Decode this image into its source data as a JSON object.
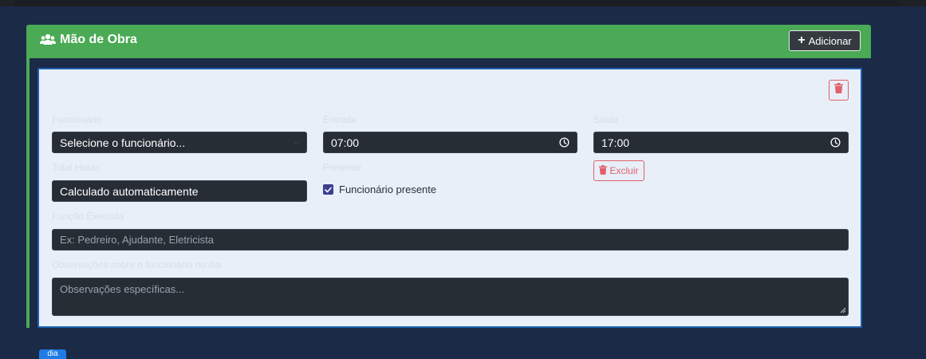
{
  "section": {
    "title": "Mão de Obra",
    "title_icon": "users-icon",
    "add_button_label": "Adicionar"
  },
  "worker_card": {
    "funcionario": {
      "label": "Funcionário",
      "value": "Selecione o funcionário..."
    },
    "entrada": {
      "label": "Entrada",
      "value": "07:00"
    },
    "saida": {
      "label": "Saída",
      "value": "17:00"
    },
    "total_horas": {
      "label": "Total Horas",
      "value": "Calculado automaticamente"
    },
    "presente": {
      "label": "Presente",
      "checkbox_label": "Funcionário presente",
      "checked": true
    },
    "excluir_button_label": "Excluir",
    "funcao": {
      "label": "Função Exercida",
      "placeholder": "Ex: Pedreiro, Ajudante, Eletricista"
    },
    "observacoes": {
      "label": "Observações sobre o funcionário no dia",
      "placeholder": "Observações específicas..."
    }
  },
  "bottom_badge_label": "dia",
  "colors": {
    "header_green": "#4aaa55",
    "card_bg": "#e8eff9",
    "card_border": "#1c5fb0",
    "danger": "#e0606a",
    "input_bg": "#272d35",
    "page_bg": "#1b2a47"
  }
}
